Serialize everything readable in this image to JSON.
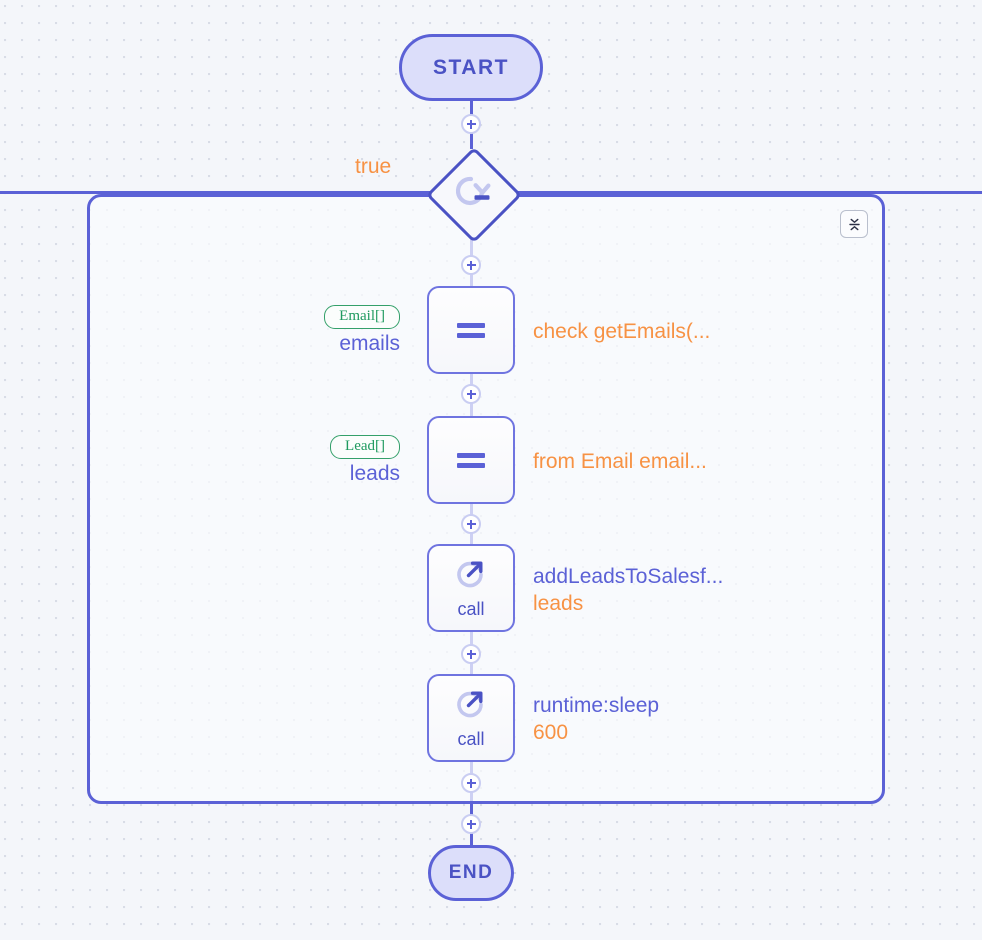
{
  "diagram": {
    "type": "flowchart",
    "background": "#f4f6fa",
    "accent_color": "#5b61d6",
    "expression_color": "#f79244",
    "type_badge_color": "#1f9a5f"
  },
  "nodes": {
    "start": {
      "label": "START",
      "shape": "stadium"
    },
    "loop": {
      "icon": "loop-repeat-icon",
      "shape": "diamond",
      "condition_label": "true"
    },
    "assign_emails": {
      "operator": "=",
      "type_badge": "Email[]",
      "variable": "emails",
      "expression": "check getEmails(..."
    },
    "assign_leads": {
      "operator": "=",
      "type_badge": "Lead[]",
      "variable": "leads",
      "expression": "from Email email..."
    },
    "call_salesforce": {
      "kind": "call",
      "icon": "call-arrow-icon",
      "target": "addLeadsToSalesf...",
      "argument": "leads"
    },
    "call_sleep": {
      "kind": "call",
      "icon": "call-arrow-icon",
      "target": "runtime:sleep",
      "argument": "600"
    },
    "end": {
      "label": "END",
      "shape": "stadium"
    }
  },
  "container": {
    "collapse_button": {
      "icon": "collapse-vertical-icon",
      "title": "Collapse"
    }
  },
  "add_handles": {
    "glyph": "+",
    "count": 7
  }
}
